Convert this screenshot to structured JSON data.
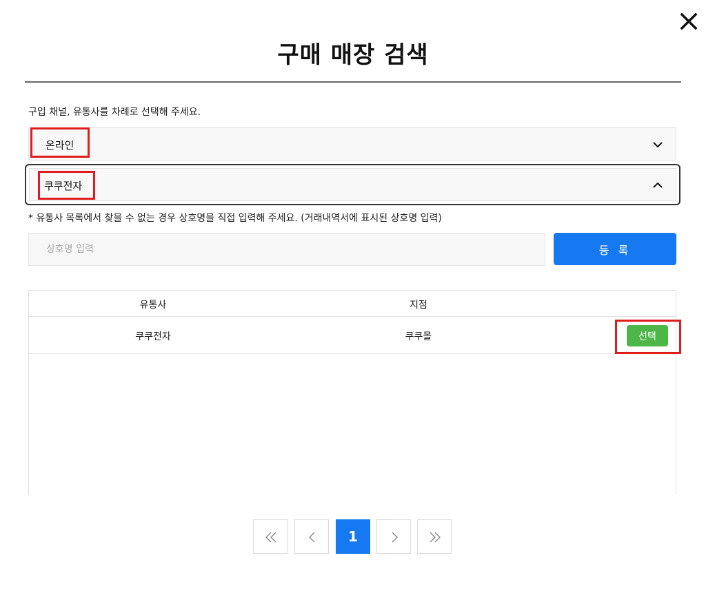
{
  "dialog": {
    "title": "구매 매장 검색",
    "close_icon": "close-icon"
  },
  "instruction": "구입 채널, 유통사를 차례로 선택해 주세요.",
  "channel_select": {
    "value": "온라인",
    "state": "collapsed",
    "icon": "chevron-down-icon"
  },
  "distributor_select": {
    "value": "쿠쿠전자",
    "state": "expanded",
    "icon": "chevron-up-icon"
  },
  "note": "* 유통사 목록에서 찾을 수 없는 경우 상호명을 직접 입력해 주세요. (거래내역서에 표시된 상호명 입력)",
  "store_name_input": {
    "placeholder": "상호명 입력",
    "value": ""
  },
  "register_button": {
    "label": "등 록"
  },
  "table": {
    "headers": [
      "유통사",
      "지점"
    ],
    "rows": [
      {
        "distributor": "쿠쿠전자",
        "branch": "쿠쿠몰",
        "action": "선택"
      }
    ]
  },
  "pagination": {
    "current_page": "1"
  },
  "colors": {
    "primary": "#1679f2",
    "select_button": "#4cb648",
    "highlight": "#e01b1b"
  }
}
